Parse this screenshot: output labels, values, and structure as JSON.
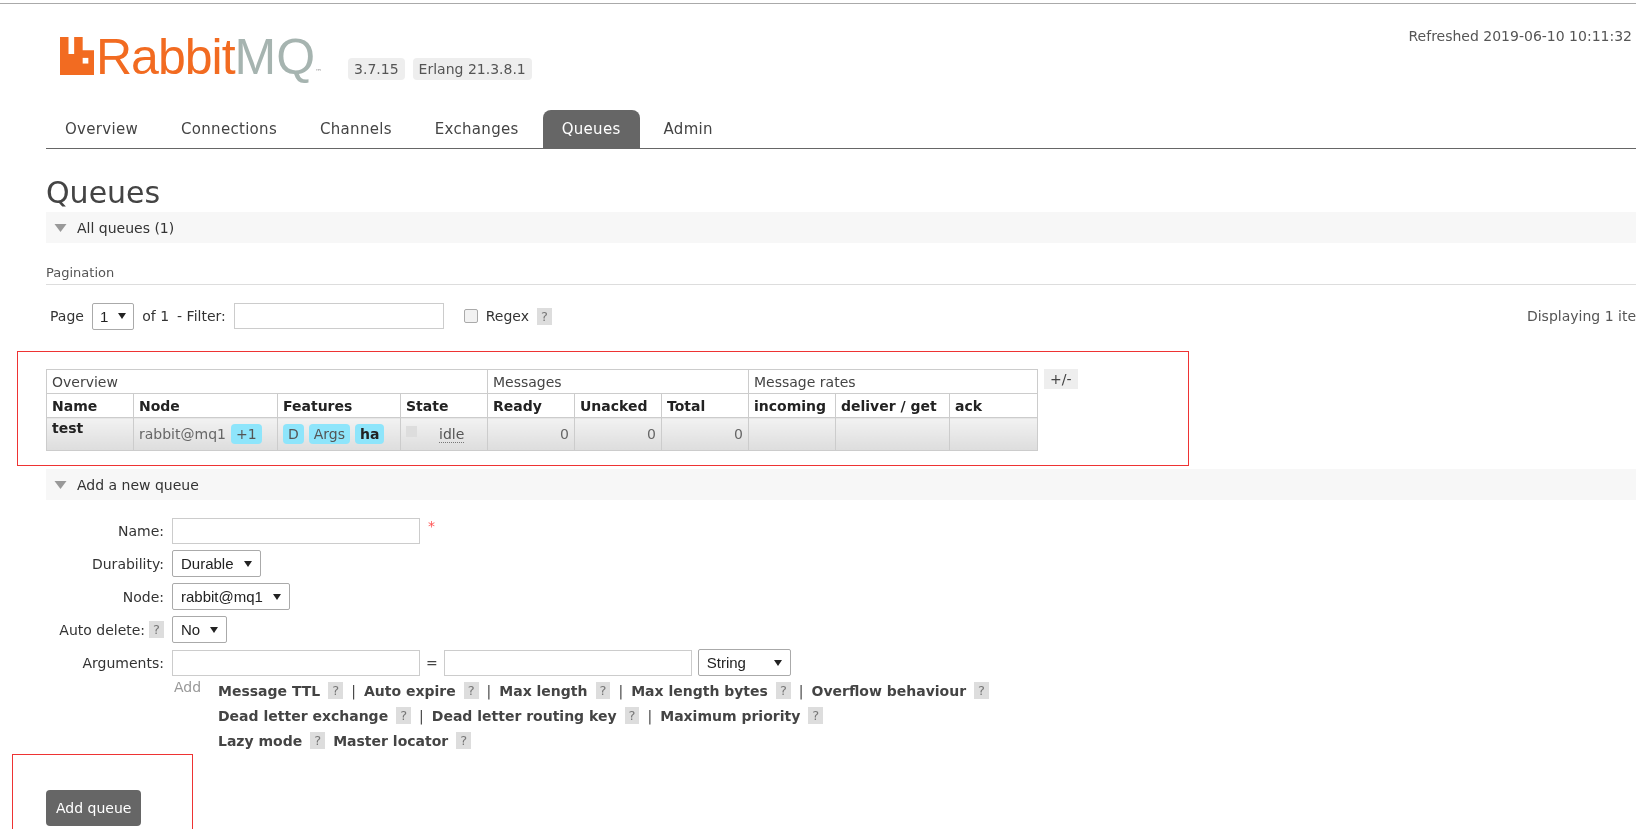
{
  "header": {
    "logo": {
      "brand": "Rabbit",
      "suffix": "MQ",
      "mark": "™"
    },
    "versions": [
      "3.7.15",
      "Erlang 21.3.8.1"
    ],
    "refreshed": "Refreshed 2019-06-10 10:11:32"
  },
  "tabs": [
    {
      "label": "Overview",
      "selected": false
    },
    {
      "label": "Connections",
      "selected": false
    },
    {
      "label": "Channels",
      "selected": false
    },
    {
      "label": "Exchanges",
      "selected": false
    },
    {
      "label": "Queues",
      "selected": true
    },
    {
      "label": "Admin",
      "selected": false
    }
  ],
  "page_title": "Queues",
  "all_queues": {
    "title": "All queues (1)",
    "expanded": true,
    "pagination": {
      "heading": "Pagination",
      "page_label": "Page",
      "page_value": "1",
      "of": "of 1",
      "filter_label": "- Filter:",
      "regex": {
        "label": "Regex",
        "checked": false,
        "help": "?"
      },
      "displaying": "Displaying 1 ite"
    },
    "table": {
      "highlighted": true,
      "toggle": "+/-",
      "groups": [
        {
          "label": "Overview",
          "columns": [
            "Name",
            "Node",
            "Features",
            "State"
          ]
        },
        {
          "label": "Messages",
          "columns": [
            "Ready",
            "Unacked",
            "Total"
          ]
        },
        {
          "label": "Message rates",
          "columns": [
            "incoming",
            "deliver / get",
            "ack"
          ]
        }
      ],
      "rows": [
        {
          "name": "test",
          "node": "rabbit@mq1",
          "node_extra": "+1",
          "features": [
            {
              "label": "D",
              "emphasis": false
            },
            {
              "label": "Args",
              "emphasis": false
            },
            {
              "label": "ha",
              "emphasis": true
            }
          ],
          "state": "idle",
          "ready": "0",
          "unacked": "0",
          "total": "0"
        }
      ]
    }
  },
  "add_queue": {
    "title": "Add a new queue",
    "expanded": true,
    "fields": [
      {
        "kind": "text",
        "label": "Name:",
        "required": "*"
      },
      {
        "kind": "select",
        "label": "Durability:",
        "value": "Durable"
      },
      {
        "kind": "select",
        "label": "Node:",
        "value": "rabbit@mq1"
      },
      {
        "kind": "select",
        "label": "Auto delete:",
        "help": "?",
        "value": "No"
      },
      {
        "kind": "arguments",
        "label": "Arguments:",
        "equals": "=",
        "type": "String"
      }
    ],
    "add_label": "Add",
    "argument_lines": [
      [
        {
          "label": "Message TTL",
          "help": "?",
          "sep": "|"
        },
        {
          "label": "Auto expire",
          "help": "?",
          "sep": "|"
        },
        {
          "label": "Max length",
          "help": "?",
          "sep": "|"
        },
        {
          "label": "Max length bytes",
          "help": "?",
          "sep": "|"
        },
        {
          "label": "Overflow behaviour",
          "help": "?"
        }
      ],
      [
        {
          "label": "Dead letter exchange",
          "help": "?",
          "sep": "|"
        },
        {
          "label": "Dead letter routing key",
          "help": "?",
          "sep": "|"
        },
        {
          "label": "Maximum priority",
          "help": "?"
        }
      ],
      [
        {
          "label": "Lazy mode",
          "help": "?"
        },
        {
          "label": "Master locator",
          "help": "?"
        }
      ]
    ],
    "button": {
      "label": "Add queue",
      "highlighted": true
    }
  }
}
